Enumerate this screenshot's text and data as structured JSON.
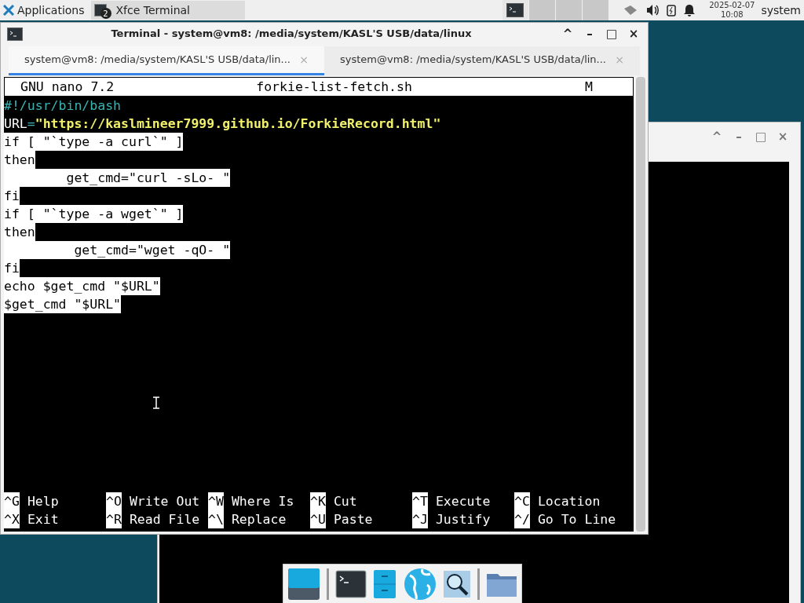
{
  "top_panel": {
    "applications_menu": "Applications",
    "tasks": [
      {
        "label": "Xfce Terminal",
        "badge": "2",
        "selected": true
      }
    ],
    "workspaces": [
      {
        "selected": true
      },
      {
        "selected": false
      },
      {
        "selected": false
      },
      {
        "selected": false
      }
    ],
    "clock": {
      "date": "2025-02-07",
      "time": "10:08"
    },
    "user": "system"
  },
  "terminal_window": {
    "title": "Terminal - system@vm8: /media/system/KASL'S USB/data/linux",
    "title_buttons": [
      "^",
      "–",
      "□",
      "×"
    ],
    "tabs": [
      {
        "label": "system@vm8: /media/system/KASL'S USB/data/lin...",
        "close": "×",
        "selected": true
      },
      {
        "label": "system@vm8: /media/system/KASL'S USB/data/lin...",
        "close": "×",
        "selected": false
      }
    ],
    "nano": {
      "version": "GNU nano 7.2",
      "filename": "forkie-list-fetch.sh",
      "modified": "M",
      "lines": [
        {
          "selected": false,
          "segments": [
            {
              "kind": "comment",
              "text": "#!/usr/bin/bash"
            }
          ]
        },
        {
          "selected": false,
          "segments": [
            {
              "kind": "plain",
              "text": "URL"
            },
            {
              "kind": "operator",
              "text": "="
            },
            {
              "kind": "string",
              "text": "\"https://kaslmineer7999.github.io/ForkieRecord.html\""
            }
          ]
        },
        {
          "selected": true,
          "segments": [
            {
              "kind": "plain",
              "text": "if [ \"`type -a curl`\" ]"
            }
          ]
        },
        {
          "selected": true,
          "segments": [
            {
              "kind": "plain",
              "text": "then"
            }
          ]
        },
        {
          "selected": true,
          "segments": [
            {
              "kind": "plain",
              "text": "        get_cmd=\"curl -sLo- \""
            }
          ]
        },
        {
          "selected": true,
          "segments": [
            {
              "kind": "plain",
              "text": "fi"
            }
          ]
        },
        {
          "selected": true,
          "segments": [
            {
              "kind": "plain",
              "text": "if [ \"`type -a wget`\" ]"
            }
          ]
        },
        {
          "selected": true,
          "segments": [
            {
              "kind": "plain",
              "text": "then"
            }
          ]
        },
        {
          "selected": true,
          "segments": [
            {
              "kind": "plain",
              "text": "         get_cmd=\"wget -qO- \""
            }
          ]
        },
        {
          "selected": true,
          "segments": [
            {
              "kind": "plain",
              "text": "fi"
            }
          ]
        },
        {
          "selected": true,
          "segments": [
            {
              "kind": "plain",
              "text": "echo $get_cmd \"$URL\""
            }
          ]
        },
        {
          "selected": true,
          "segments": [
            {
              "kind": "plain",
              "text": "$get_cmd \"$URL\""
            }
          ]
        }
      ],
      "shortcuts": [
        [
          {
            "key": "^G",
            "label": "Help"
          },
          {
            "key": "^X",
            "label": "Exit"
          }
        ],
        [
          {
            "key": "^O",
            "label": "Write Out"
          },
          {
            "key": "^R",
            "label": "Read File"
          }
        ],
        [
          {
            "key": "^W",
            "label": "Where Is"
          },
          {
            "key": "^\\",
            "label": "Replace"
          }
        ],
        [
          {
            "key": "^K",
            "label": "Cut"
          },
          {
            "key": "^U",
            "label": "Paste"
          }
        ],
        [
          {
            "key": "^T",
            "label": "Execute"
          },
          {
            "key": "^J",
            "label": "Justify"
          }
        ],
        [
          {
            "key": "^C",
            "label": "Location"
          },
          {
            "key": "^/",
            "label": "Go To Line"
          }
        ]
      ]
    }
  },
  "background_window": {
    "title_buttons": [
      "^",
      "–",
      "□",
      "×"
    ]
  },
  "dock": {
    "items": [
      {
        "kind": "desktop"
      },
      {
        "kind": "separator"
      },
      {
        "kind": "terminal"
      },
      {
        "kind": "files"
      },
      {
        "kind": "browser"
      },
      {
        "kind": "search"
      },
      {
        "kind": "separator"
      },
      {
        "kind": "folder"
      }
    ]
  }
}
